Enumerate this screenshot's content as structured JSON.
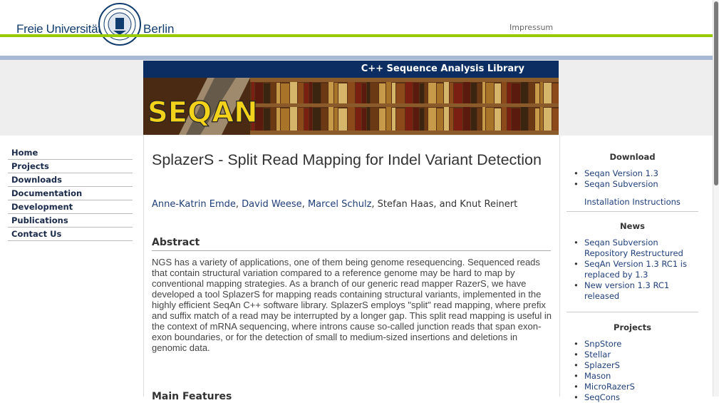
{
  "header": {
    "left_text": "Freie Universität",
    "right_text": "Berlin",
    "impressum": "Impressum"
  },
  "banner": {
    "title": "C++ Sequence Analysis Library",
    "logo": "SEQAN"
  },
  "left_nav": [
    "Home",
    "Projects",
    "Downloads",
    "Documentation",
    "Development",
    "Publications",
    "Contact Us"
  ],
  "main": {
    "title": "SplazerS - Split Read Mapping for Indel Variant Detection",
    "authors": {
      "linked": [
        "Anne-Katrin Emde",
        "David Weese",
        "Marcel Schulz"
      ],
      "plain": ", Stefan Haas, and Knut Reinert"
    },
    "abstract_heading": "Abstract",
    "abstract": "NGS has a variety of applications, one of them being genome resequencing. Sequenced reads that contain structural variation compared to a reference genome may be hard to map by conventional mapping strategies. As a branch of our generic read mapper RazerS, we have developed a tool SplazerS for mapping reads containing structural variants, implemented in the highly efficient SeqAn C++ software library. SplazerS employs \"split\" read mapping, where prefix and suffix match of a read may be interrupted by a longer gap. This split read mapping is useful in the context of mRNA sequencing, where introns cause so-called junction reads that span exon-exon boundaries, or for the detection of small to medium-sized insertions and deletions in genomic data.",
    "features_heading": "Main Features"
  },
  "sidebar": {
    "download_heading": "Download",
    "downloads": [
      "Seqan Version 1.3",
      "Seqan Subversion"
    ],
    "install": "Installation Instructions",
    "news_heading": "News",
    "news": [
      "Seqan Subversion Repository Restructured",
      "SeqAn Version 1.3 RC1 is replaced by 1.3",
      "New version 1.3 RC1 released"
    ],
    "projects_heading": "Projects",
    "projects": [
      "SnpStore",
      "Stellar",
      "SplazerS",
      "Mason",
      "MicroRazerS",
      "SeqCons"
    ]
  },
  "colors": {
    "accent_green": "#99cc00",
    "navy": "#0b2d62",
    "link": "#1f3f7a"
  }
}
